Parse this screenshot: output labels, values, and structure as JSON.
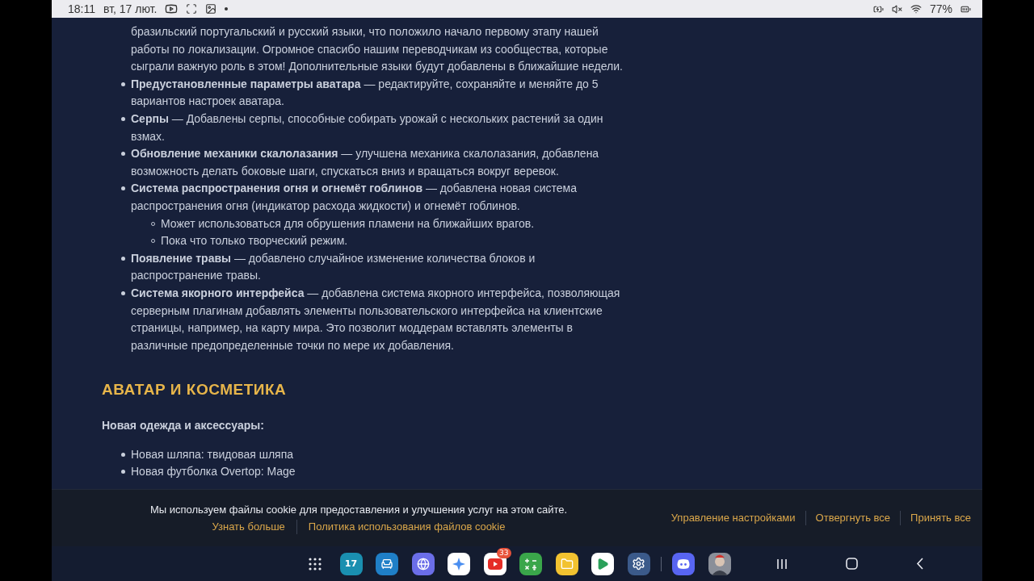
{
  "status_bar": {
    "time": "18:11",
    "date": "вт, 17 лют.",
    "battery": "77%"
  },
  "article": {
    "lead_tail": "бразильский португальский и русский языки, что положило начало первому этапу нашей работы по локализации. Огромное спасибо нашим переводчикам из сообщества, которые сыграли важную роль в этом! Дополнительные языки будут добавлены в ближайшие недели.",
    "items": [
      {
        "title": "Предустановленные параметры аватара",
        "text": " — редактируйте, сохраняйте и меняйте до 5 вариантов настроек аватара."
      },
      {
        "title": "Серпы",
        "text": " — Добавлены серпы, способные собирать урожай с нескольких растений за один взмах."
      },
      {
        "title": "Обновление механики скалолазания",
        "text": " — улучшена механика скалолазания, добавлена возможность делать боковые шаги, спускаться вниз и вращаться вокруг веревок."
      },
      {
        "title": "Система распространения огня и огнемёт гоблинов",
        "text": " — добавлена новая система распространения огня (индикатор расхода жидкости) и огнемёт гоблинов.",
        "children": [
          "Может использоваться для обрушения пламени на ближайших врагов.",
          "Пока что только творческий режим."
        ]
      },
      {
        "title": "Появление травы",
        "text": " — добавлено случайное изменение количества блоков и распространение травы."
      },
      {
        "title": "Система якорного интерфейса",
        "text": " — добавлена система якорного интерфейса, позволяющая серверным плагинам добавлять элементы пользовательского интерфейса на клиентские страницы, например, на карту мира. Это позволит моддерам вставлять элементы в различные предопределенные точки по мере их добавления."
      }
    ],
    "heading": "АВАТАР И КОСМЕТИКА",
    "subheading": "Новая одежда и аксессуары:",
    "list": [
      "Новая шляпа: твидовая шляпа",
      "Новая футболка Overtop: Mage"
    ]
  },
  "cookie_bar": {
    "message": "Мы используем файлы cookie для предоставления и улучшения услуг на этом сайте.",
    "links": [
      "Узнать больше",
      "Политика использования файлов cookie"
    ],
    "actions": [
      "Управление настройками",
      "Отвергнуть все",
      "Принять все"
    ]
  },
  "taskbar": {
    "apps": [
      {
        "kind": "grid"
      },
      {
        "kind": "calendar",
        "label": "17"
      },
      {
        "kind": "bench"
      },
      {
        "kind": "browser"
      },
      {
        "kind": "sparkle"
      },
      {
        "kind": "video",
        "badge": "33"
      },
      {
        "kind": "calculator"
      },
      {
        "kind": "folder"
      },
      {
        "kind": "store"
      },
      {
        "kind": "settings"
      },
      {
        "kind": "divider"
      },
      {
        "kind": "chat"
      },
      {
        "kind": "avatar"
      }
    ]
  }
}
